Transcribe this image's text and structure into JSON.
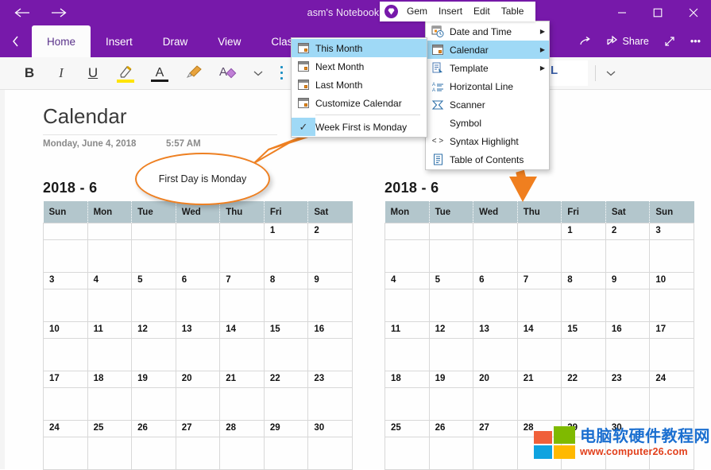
{
  "window": {
    "title": "asm's Notebook » Qu",
    "back_icon": "arrow-left-icon",
    "forward_icon": "arrow-right-icon",
    "minimize_label": "—",
    "maximize_label": "□",
    "close_label": "✕"
  },
  "ribbon": {
    "collapse_icon": "chevron-left-icon",
    "tabs": [
      {
        "label": "Home",
        "active": true
      },
      {
        "label": "Insert",
        "active": false
      },
      {
        "label": "Draw",
        "active": false
      },
      {
        "label": "View",
        "active": false
      },
      {
        "label": "Class Notebook",
        "active": false
      }
    ],
    "right_items": [
      {
        "label": "",
        "icon": "redo-icon"
      },
      {
        "label": "Share",
        "icon": "share-icon"
      },
      {
        "label": "",
        "icon": "expand-icon"
      },
      {
        "label": "•••",
        "icon": "more-icon"
      }
    ]
  },
  "formatbar": {
    "bold": "B",
    "italic": "I",
    "underline": "U",
    "highlight_icon": "highlighter-icon",
    "font_color_icon": "font-color-icon",
    "format_painter_icon": "format-painter-icon",
    "clear_format_icon": "clear-formatting-icon",
    "more_chevron": "chevron-down-icon",
    "style_value": "L",
    "style_chevron": "chevron-down-icon"
  },
  "gembar": {
    "logo_icon": "gem-logo-icon",
    "items": [
      "Gem",
      "Insert",
      "Edit",
      "Table"
    ]
  },
  "gem_menu": {
    "items": [
      {
        "label": "Date and Time",
        "icon": "date-time-icon",
        "submenu": true,
        "selected": false
      },
      {
        "label": "Calendar",
        "icon": "calendar-icon",
        "submenu": true,
        "selected": true
      },
      {
        "label": "Template",
        "icon": "template-icon",
        "submenu": true,
        "selected": false
      },
      {
        "label": "Horizontal Line",
        "icon": "horizontal-line-icon",
        "submenu": false,
        "selected": false
      },
      {
        "label": "Scanner",
        "icon": "scanner-icon",
        "submenu": false,
        "selected": false
      },
      {
        "label": "Symbol",
        "icon": "symbol-icon",
        "submenu": false,
        "selected": false
      },
      {
        "label": "Syntax Highlight",
        "icon": "syntax-highlight-icon",
        "submenu": false,
        "selected": false
      },
      {
        "label": "Table of Contents",
        "icon": "table-of-contents-icon",
        "submenu": false,
        "selected": false
      }
    ]
  },
  "calendar_submenu": {
    "items": [
      {
        "label": "This Month",
        "icon": "calendar-icon",
        "selected": true,
        "checked": false
      },
      {
        "label": "Next Month",
        "icon": "calendar-icon",
        "selected": false,
        "checked": false
      },
      {
        "label": "Last Month",
        "icon": "calendar-icon",
        "selected": false,
        "checked": false
      },
      {
        "label": "Customize Calendar",
        "icon": "calendar-icon",
        "selected": false,
        "checked": false
      }
    ],
    "checked_item": {
      "label": "Week First is Monday",
      "icon": "checkmark-icon",
      "checked": true,
      "selected": true
    }
  },
  "page": {
    "title": "Calendar",
    "date": "Monday, June 4, 2018",
    "time": "5:57 AM"
  },
  "callout": {
    "text": "First Day is Monday",
    "color": "#ee8022"
  },
  "calendars": [
    {
      "id": "calendar-sunday-first",
      "heading": "2018 - 6",
      "headers": [
        "Sun",
        "Mon",
        "Tue",
        "Wed",
        "Thu",
        "Fri",
        "Sat"
      ],
      "weeks": [
        [
          "",
          "",
          "",
          "",
          "",
          "1",
          "2"
        ],
        [
          "3",
          "4",
          "5",
          "6",
          "7",
          "8",
          "9"
        ],
        [
          "10",
          "11",
          "12",
          "13",
          "14",
          "15",
          "16"
        ],
        [
          "17",
          "18",
          "19",
          "20",
          "21",
          "22",
          "23"
        ],
        [
          "24",
          "25",
          "26",
          "27",
          "28",
          "29",
          "30"
        ]
      ]
    },
    {
      "id": "calendar-monday-first",
      "heading": "2018 - 6",
      "headers": [
        "Mon",
        "Tue",
        "Wed",
        "Thu",
        "Fri",
        "Sat",
        "Sun"
      ],
      "weeks": [
        [
          "",
          "",
          "",
          "",
          "1",
          "2",
          "3"
        ],
        [
          "4",
          "5",
          "6",
          "7",
          "8",
          "9",
          "10"
        ],
        [
          "11",
          "12",
          "13",
          "14",
          "15",
          "16",
          "17"
        ],
        [
          "18",
          "19",
          "20",
          "21",
          "22",
          "23",
          "24"
        ],
        [
          "25",
          "26",
          "27",
          "28",
          "29",
          "30",
          ""
        ]
      ]
    }
  ],
  "watermark": {
    "chinese": "电脑软硬件教程网",
    "url": "www.computer26.com",
    "logo_icon": "windows-logo-icon"
  },
  "colors": {
    "brand_purple": "#7719aa",
    "accent_orange": "#ee8022",
    "header_blue_gray": "#b3c6cc",
    "menu_highlight": "#9fd9f6"
  }
}
